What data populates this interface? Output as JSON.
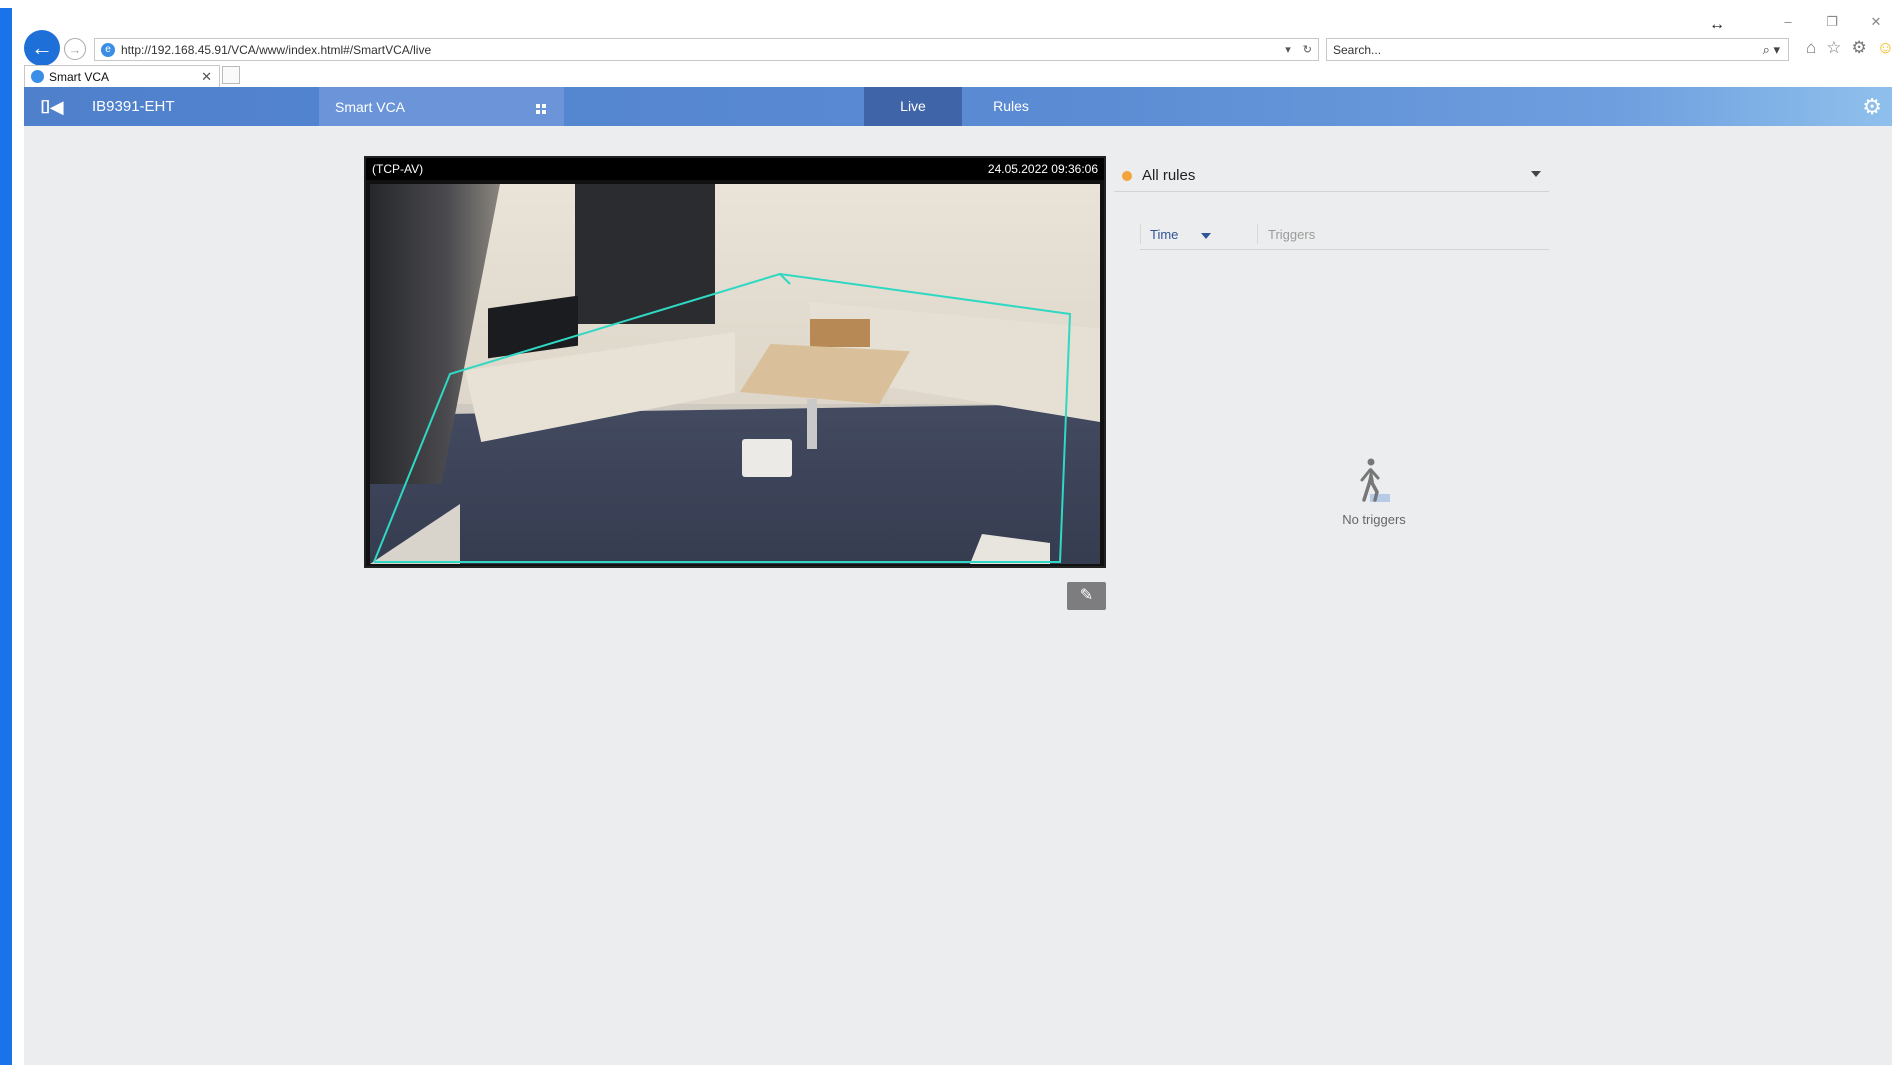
{
  "browser": {
    "url": "http://192.168.45.91/VCA/www/index.html#/SmartVCA/live",
    "search_placeholder": "Search...",
    "tab_title": "Smart VCA",
    "controls": {
      "minimize": "–",
      "restore": "❐",
      "close": "✕"
    },
    "resize_glyph": "↔"
  },
  "app": {
    "device_name": "IB9391-EHT",
    "section": "Smart VCA",
    "tabs": [
      {
        "label": "Live",
        "active": true
      },
      {
        "label": "Rules",
        "active": false
      }
    ],
    "accent": "#4f80cc",
    "active_tab_color": "#3f64a8"
  },
  "video": {
    "source": "(TCP-AV)",
    "timestamp": "24.05.2022 09:36:06",
    "zone_color": "#2fd8c2"
  },
  "rules_panel": {
    "filter_label": "All rules",
    "filter_dot_color": "#f2a33a",
    "columns": {
      "time": "Time",
      "triggers": "Triggers"
    },
    "empty_text": "No triggers"
  },
  "icons": {
    "back": "arrow-left-icon",
    "forward": "arrow-right-icon",
    "settings": "gear-icon",
    "tool": "wrench-icon"
  }
}
